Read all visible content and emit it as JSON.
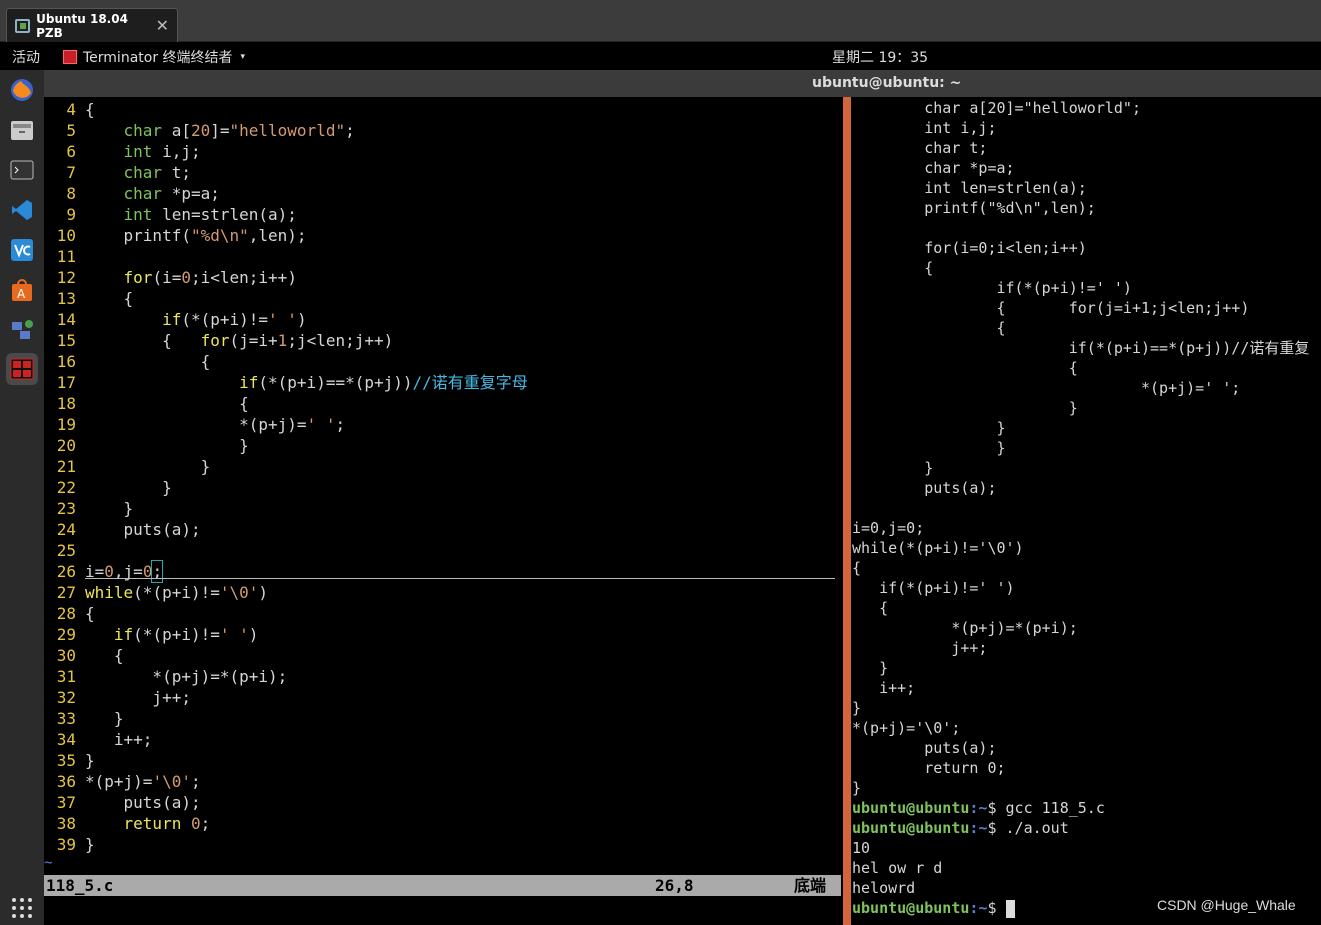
{
  "vm": {
    "tab_title": "Ubuntu 18.04 PZB",
    "close_glyph": "✕"
  },
  "topbar": {
    "activities": "活动",
    "app_name": "Terminator 终端终结者",
    "app_arrow": "▾",
    "clock": "星期二 19：35"
  },
  "dock": {
    "items": [
      "firefox-icon",
      "files-icon",
      "terminal-icon",
      "vscode-icon",
      "vnc-icon",
      "software-center-icon",
      "network-tools-icon",
      "terminator-icon",
      "show-applications-icon"
    ]
  },
  "window": {
    "title": "ubuntu@ubuntu: ~"
  },
  "vim": {
    "lines": [
      {
        "n": "4",
        "t": "{"
      },
      {
        "n": "5",
        "t": "    char a[20]=\"helloworld\";"
      },
      {
        "n": "6",
        "t": "    int i,j;"
      },
      {
        "n": "7",
        "t": "    char t;"
      },
      {
        "n": "8",
        "t": "    char *p=a;"
      },
      {
        "n": "9",
        "t": "    int len=strlen(a);"
      },
      {
        "n": "10",
        "t": "    printf(\"%d\\n\",len);"
      },
      {
        "n": "11",
        "t": ""
      },
      {
        "n": "12",
        "t": "    for(i=0;i<len;i++)"
      },
      {
        "n": "13",
        "t": "    {"
      },
      {
        "n": "14",
        "t": "        if(*(p+i)!=' ')"
      },
      {
        "n": "15",
        "t": "        {   for(j=i+1;j<len;j++)"
      },
      {
        "n": "16",
        "t": "            {"
      },
      {
        "n": "17",
        "t": "                if(*(p+i)==*(p+j))//诺有重复字母"
      },
      {
        "n": "18",
        "t": "                {"
      },
      {
        "n": "19",
        "t": "                *(p+j)=' ';"
      },
      {
        "n": "20",
        "t": "                }"
      },
      {
        "n": "21",
        "t": "            }"
      },
      {
        "n": "22",
        "t": "        }"
      },
      {
        "n": "23",
        "t": "    }"
      },
      {
        "n": "24",
        "t": "    puts(a);"
      },
      {
        "n": "25",
        "t": ""
      },
      {
        "n": "26",
        "t": "i=0,j=0;"
      },
      {
        "n": "27",
        "t": "while(*(p+i)!='\\0')"
      },
      {
        "n": "28",
        "t": "{"
      },
      {
        "n": "29",
        "t": "   if(*(p+i)!=' ')"
      },
      {
        "n": "30",
        "t": "   {"
      },
      {
        "n": "31",
        "t": "       *(p+j)=*(p+i);"
      },
      {
        "n": "32",
        "t": "       j++;"
      },
      {
        "n": "33",
        "t": "   }"
      },
      {
        "n": "34",
        "t": "   i++;"
      },
      {
        "n": "35",
        "t": "}"
      },
      {
        "n": "36",
        "t": "*(p+j)='\\0';"
      },
      {
        "n": "37",
        "t": "    puts(a);"
      },
      {
        "n": "38",
        "t": "    return 0;"
      },
      {
        "n": "39",
        "t": "}"
      }
    ],
    "tilde": "~",
    "status": {
      "filename": "118_5.c",
      "position": "26,8",
      "scroll": "底端"
    }
  },
  "terminal": {
    "lines": [
      "        char a[20]=\"helloworld\";",
      "        int i,j;",
      "        char t;",
      "        char *p=a;",
      "        int len=strlen(a);",
      "        printf(\"%d\\n\",len);",
      "",
      "        for(i=0;i<len;i++)",
      "        {",
      "                if(*(p+i)!=' ')",
      "                {       for(j=i+1;j<len;j++)",
      "                {",
      "                        if(*(p+i)==*(p+j))//诺有重复",
      "                        {",
      "                                *(p+j)=' ';",
      "                        }",
      "                }",
      "                }",
      "        }",
      "        puts(a);",
      "",
      "i=0,j=0;",
      "while(*(p+i)!='\\0')",
      "{",
      "   if(*(p+i)!=' ')",
      "   {",
      "           *(p+j)=*(p+i);",
      "           j++;",
      "   }",
      "   i++;",
      "}",
      "*(p+j)='\\0';",
      "        puts(a);",
      "        return 0;",
      "}"
    ],
    "prompt_user": "ubuntu@ubuntu",
    "prompt_path": ":~",
    "prompt_sym": "$ ",
    "cmd1": "gcc 118_5.c",
    "cmd2": "./a.out",
    "out1": "10",
    "out2": "hel ow r d",
    "out3": "helowrd"
  },
  "watermark": "CSDN @Huge_Whale"
}
